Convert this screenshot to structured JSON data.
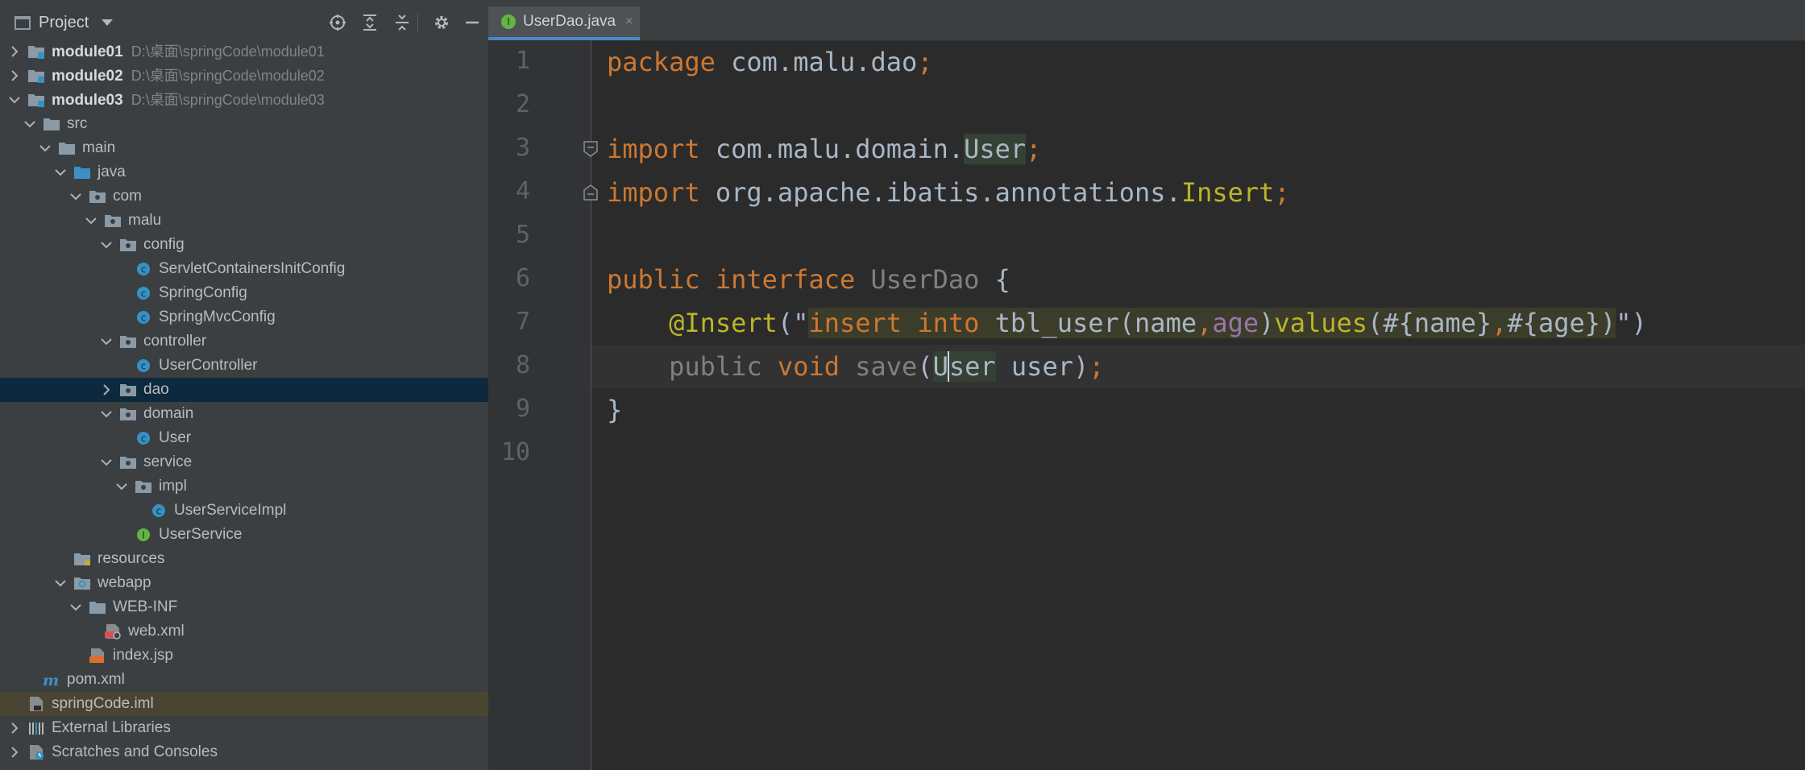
{
  "project_panel": {
    "title": "Project",
    "tree": [
      {
        "depth": 0,
        "chevron": "right",
        "icon": "module-folder",
        "label": "module01",
        "bold": true,
        "path": "D:\\桌面\\springCode\\module01"
      },
      {
        "depth": 0,
        "chevron": "right",
        "icon": "module-folder",
        "label": "module02",
        "bold": true,
        "path": "D:\\桌面\\springCode\\module02"
      },
      {
        "depth": 0,
        "chevron": "down",
        "icon": "module-folder",
        "label": "module03",
        "bold": true,
        "path": "D:\\桌面\\springCode\\module03"
      },
      {
        "depth": 1,
        "chevron": "down",
        "icon": "folder",
        "label": "src"
      },
      {
        "depth": 2,
        "chevron": "down",
        "icon": "folder",
        "label": "main"
      },
      {
        "depth": 3,
        "chevron": "down",
        "icon": "source-folder",
        "label": "java"
      },
      {
        "depth": 4,
        "chevron": "down",
        "icon": "package",
        "label": "com"
      },
      {
        "depth": 5,
        "chevron": "down",
        "icon": "package",
        "label": "malu"
      },
      {
        "depth": 6,
        "chevron": "down",
        "icon": "package",
        "label": "config"
      },
      {
        "depth": 7,
        "chevron": "none",
        "icon": "class",
        "label": "ServletContainersInitConfig"
      },
      {
        "depth": 7,
        "chevron": "none",
        "icon": "class",
        "label": "SpringConfig"
      },
      {
        "depth": 7,
        "chevron": "none",
        "icon": "class",
        "label": "SpringMvcConfig"
      },
      {
        "depth": 6,
        "chevron": "down",
        "icon": "package",
        "label": "controller"
      },
      {
        "depth": 7,
        "chevron": "none",
        "icon": "class",
        "label": "UserController"
      },
      {
        "depth": 6,
        "chevron": "right",
        "icon": "package",
        "label": "dao",
        "selected": true
      },
      {
        "depth": 6,
        "chevron": "down",
        "icon": "package",
        "label": "domain"
      },
      {
        "depth": 7,
        "chevron": "none",
        "icon": "class",
        "label": "User"
      },
      {
        "depth": 6,
        "chevron": "down",
        "icon": "package",
        "label": "service"
      },
      {
        "depth": 7,
        "chevron": "down",
        "icon": "package",
        "label": "impl"
      },
      {
        "depth": 8,
        "chevron": "none",
        "icon": "class",
        "label": "UserServiceImpl"
      },
      {
        "depth": 7,
        "chevron": "none",
        "icon": "interface",
        "label": "UserService"
      },
      {
        "depth": 3,
        "chevron": "none",
        "icon": "resources-folder",
        "label": "resources"
      },
      {
        "depth": 3,
        "chevron": "down",
        "icon": "web-folder",
        "label": "webapp"
      },
      {
        "depth": 4,
        "chevron": "down",
        "icon": "folder",
        "label": "WEB-INF"
      },
      {
        "depth": 5,
        "chevron": "none",
        "icon": "xml-file",
        "label": "web.xml"
      },
      {
        "depth": 4,
        "chevron": "none",
        "icon": "jsp-file",
        "label": "index.jsp"
      },
      {
        "depth": 1,
        "chevron": "none",
        "icon": "maven-file",
        "label": "pom.xml"
      },
      {
        "depth": 0,
        "chevron": "none",
        "icon": "iml-file",
        "label": "springCode.iml",
        "highlighted": true
      },
      {
        "depth": 0,
        "chevron": "right",
        "icon": "libraries",
        "label": "External Libraries"
      },
      {
        "depth": 0,
        "chevron": "right",
        "icon": "scratches",
        "label": "Scratches and Consoles"
      }
    ]
  },
  "editor": {
    "tab": {
      "label": "UserDao.java",
      "close": "×",
      "icon": "I"
    },
    "line_numbers": [
      "1",
      "2",
      "3",
      "4",
      "5",
      "6",
      "7",
      "8",
      "9",
      "10"
    ],
    "current_line": 8,
    "lines": [
      [
        {
          "t": "package",
          "c": "kw"
        },
        {
          "t": " com.malu.dao"
        },
        {
          "t": ";",
          "c": "kw"
        }
      ],
      [],
      [
        {
          "t": "import",
          "c": "kw"
        },
        {
          "t": " com.malu.domain."
        },
        {
          "t": "User",
          "c": "usage"
        },
        {
          "t": ";",
          "c": "kw"
        }
      ],
      [
        {
          "t": "import",
          "c": "kw"
        },
        {
          "t": " org.apache.ibatis.annotations."
        },
        {
          "t": "Insert",
          "c": "ty"
        },
        {
          "t": ";",
          "c": "kw"
        }
      ],
      [],
      [
        {
          "t": "public",
          "c": "kw"
        },
        {
          "t": " "
        },
        {
          "t": "interface",
          "c": "kw"
        },
        {
          "t": " "
        },
        {
          "t": "UserDao",
          "c": "unused"
        },
        {
          "t": " {"
        }
      ],
      [
        {
          "t": "    "
        },
        {
          "t": "@Insert",
          "c": "an"
        },
        {
          "t": "(\""
        },
        {
          "t": "insert",
          "c": "inj sqlkw"
        },
        {
          "t": " ",
          "c": "inj"
        },
        {
          "t": "into",
          "c": "inj sqlkw"
        },
        {
          "t": " tbl_user(name",
          "c": "inj"
        },
        {
          "t": ",",
          "c": "inj sqlkw"
        },
        {
          "t": "age",
          "c": "inj sqlmagenta"
        },
        {
          "t": ")",
          "c": "inj"
        },
        {
          "t": "values",
          "c": "inj ty"
        },
        {
          "t": "(#{name}",
          "c": "inj"
        },
        {
          "t": ",",
          "c": "inj sqlkw"
        },
        {
          "t": "#{age})",
          "c": "inj"
        },
        {
          "t": "\")"
        }
      ],
      [
        {
          "t": "    "
        },
        {
          "t": "public",
          "c": "unused"
        },
        {
          "t": " "
        },
        {
          "t": "void",
          "c": "kw"
        },
        {
          "t": " "
        },
        {
          "t": "save",
          "c": "unused"
        },
        {
          "t": "("
        },
        {
          "t": "U",
          "c": "usage"
        },
        {
          "t": "ser",
          "c": "usage caret-after"
        },
        {
          "t": " user)"
        },
        {
          "t": ";",
          "c": "kw"
        }
      ],
      [
        {
          "t": "}"
        }
      ],
      []
    ]
  }
}
